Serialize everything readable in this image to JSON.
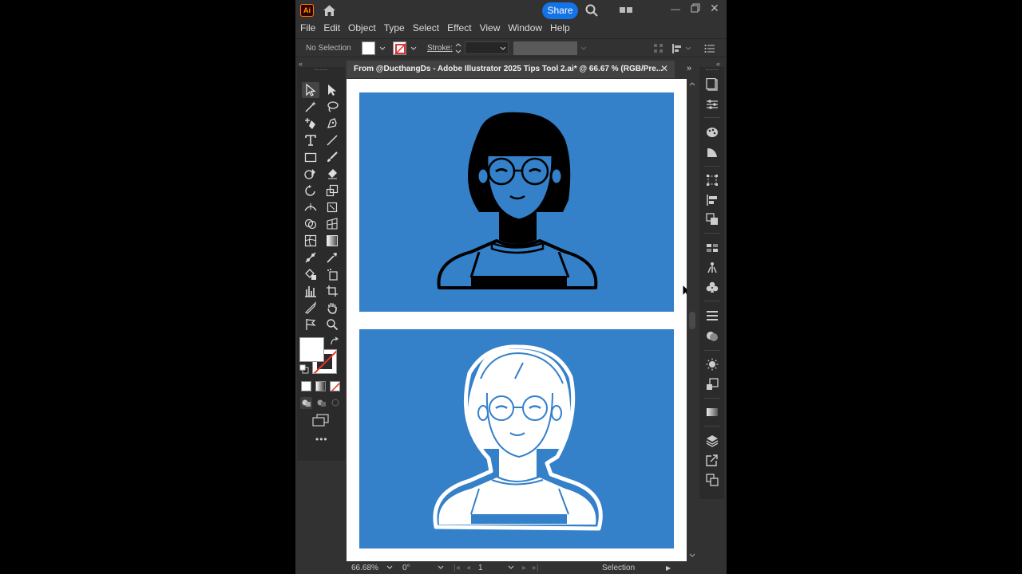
{
  "app": {
    "logo": "Ai",
    "share_label": "Share",
    "icons": [
      "home-icon",
      "search-icon",
      "arrange-documents-icon",
      "minimize-icon",
      "maximize-icon",
      "close-icon"
    ]
  },
  "menu": [
    "File",
    "Edit",
    "Object",
    "Type",
    "Select",
    "Effect",
    "View",
    "Window",
    "Help"
  ],
  "control_bar": {
    "selection_status": "No Selection",
    "fill_color": "#ffffff",
    "stroke_label": "Stroke:"
  },
  "document": {
    "tab_title": "From @DucthangDs - Adobe Illustrator 2025 Tips Tool 2.ai* @ 66.67 % (RGB/Pre...",
    "artboard_color": "#3480c9"
  },
  "status_bar": {
    "zoom": "66.68%",
    "rotation": "0°",
    "artboard_number": "1",
    "current_tool": "Selection"
  },
  "colors": {
    "accent": "#1473e6",
    "panel": "#323232",
    "toolbar": "#2b2b2b",
    "artboard_blue": "#3480c9"
  }
}
